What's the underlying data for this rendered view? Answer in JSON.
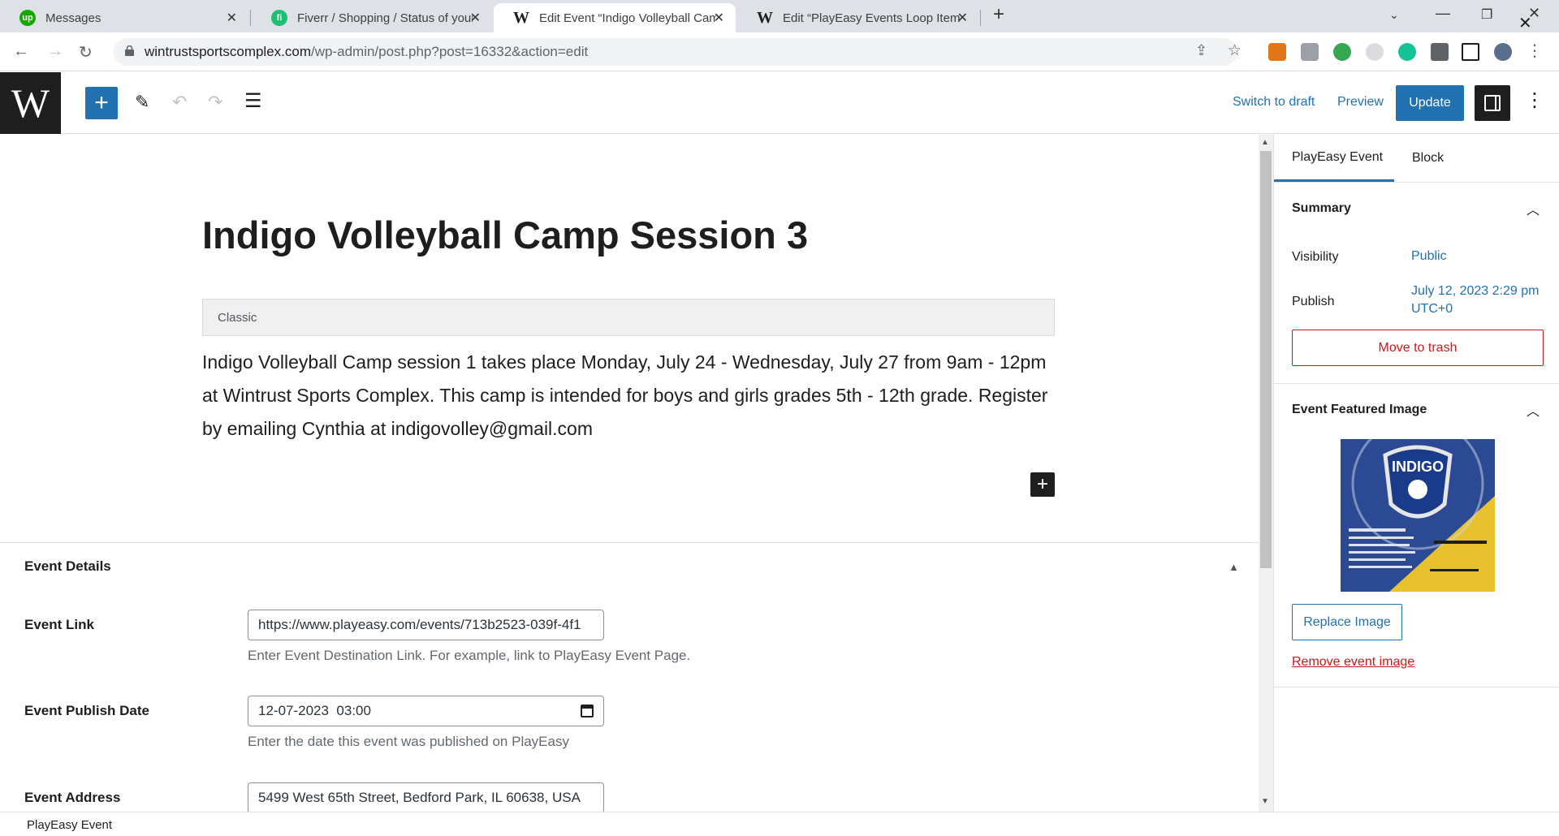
{
  "browser": {
    "tabs": [
      {
        "title": "Messages",
        "favicon": "upwork-icon",
        "color": "#14a800"
      },
      {
        "title": "Fiverr / Shopping / Status of your",
        "favicon": "fiverr-icon",
        "color": "#1dbf73"
      },
      {
        "title": "Edit Event “Indigo Volleyball Cam",
        "favicon": "wordpress-icon",
        "color": "#1e1e1e"
      },
      {
        "title": "Edit “PlayEasy Events Loop Item”",
        "favicon": "wordpress-icon",
        "color": "#1e1e1e"
      }
    ],
    "url_host": "wintrustsportscomplex.com",
    "url_path": "/wp-admin/post.php?post=16332&action=edit"
  },
  "toolbar": {
    "logo": "W",
    "switch_to_draft": "Switch to draft",
    "preview": "Preview",
    "update": "Update"
  },
  "post": {
    "title": "Indigo Volleyball Camp Session 3",
    "classic_label": "Classic",
    "content": "Indigo Volleyball Camp session 1 takes place Monday, July 24 - Wednesday, July 27 from 9am - 12pm at Wintrust Sports Complex. This camp is intended for boys and girls grades 5th - 12th grade. Register by emailing Cynthia at indigovolley@gmail.com"
  },
  "metabox": {
    "title": "Event Details",
    "fields": {
      "link_label": "Event Link",
      "link_value": "https://www.playeasy.com/events/713b2523-039f-4f1",
      "link_help": "Enter Event Destination Link. For example, link to PlayEasy Event Page.",
      "date_label": "Event Publish Date",
      "date_value": "12-07-2023  03:00",
      "date_help": "Enter the date this event was published on PlayEasy",
      "address_label": "Event Address",
      "address_value": "5499 West 65th Street, Bedford Park, IL 60638, USA"
    }
  },
  "sidebar": {
    "tab_event": "PlayEasy Event",
    "tab_block": "Block",
    "summary_title": "Summary",
    "visibility_label": "Visibility",
    "visibility_value": "Public",
    "publish_label": "Publish",
    "publish_value_line1": "July 12, 2023 2:29 pm",
    "publish_value_line2": "UTC+0",
    "trash": "Move to trash",
    "featured_title": "Event Featured Image",
    "image_logo_text": "INDIGO",
    "replace": "Replace Image",
    "remove": "Remove event image"
  },
  "footer": {
    "breadcrumb": "PlayEasy Event"
  },
  "colors": {
    "accent": "#2271b1",
    "danger": "#cc1818",
    "dark": "#1e1e1e"
  }
}
